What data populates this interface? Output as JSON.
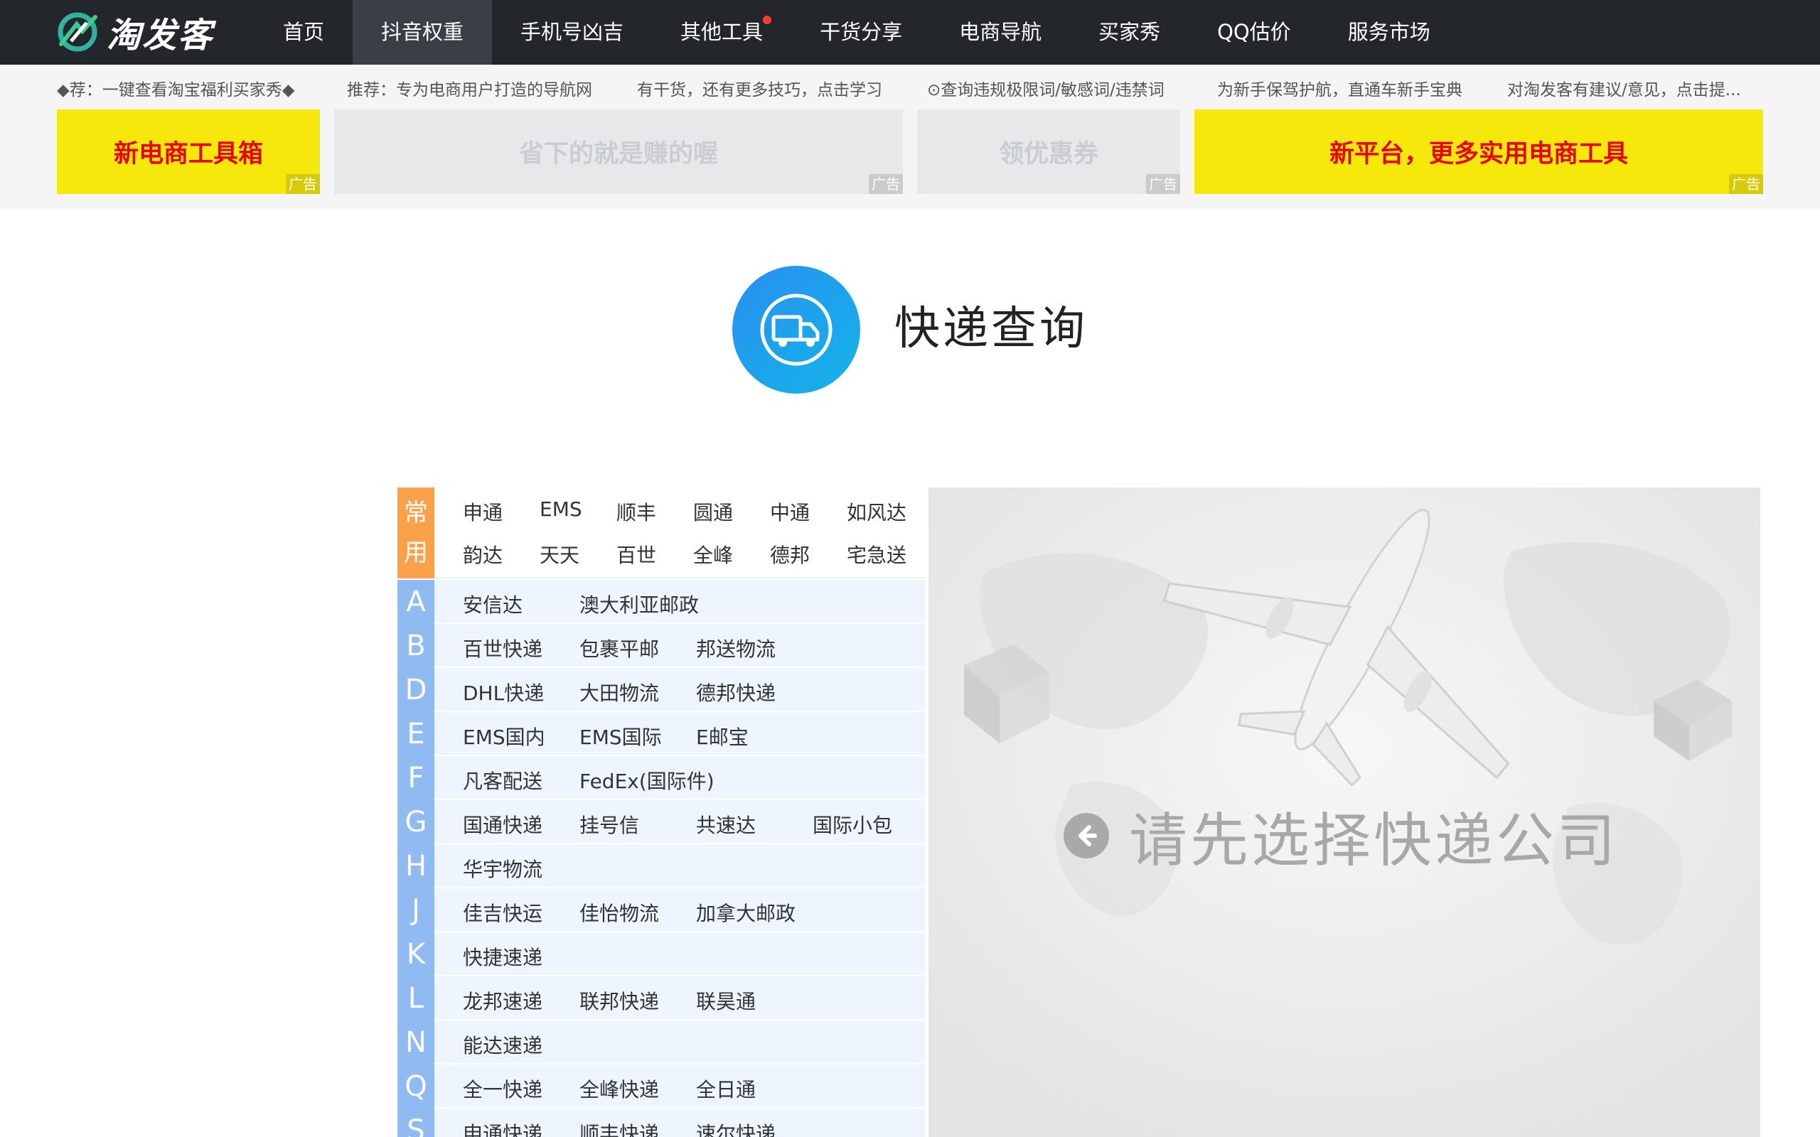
{
  "brand": {
    "name": "淘发客"
  },
  "nav": {
    "items": [
      {
        "label": "首页"
      },
      {
        "label": "抖音权重"
      },
      {
        "label": "手机号凶吉"
      },
      {
        "label": "其他工具"
      },
      {
        "label": "干货分享"
      },
      {
        "label": "电商导航"
      },
      {
        "label": "买家秀"
      },
      {
        "label": "QQ估价"
      },
      {
        "label": "服务市场"
      }
    ],
    "active_index": 1
  },
  "ticker": [
    "◆荐：一键查看淘宝福利买家秀◆",
    "推荐：专为电商用户打造的导航网",
    "有干货，还有更多技巧，点击学习",
    "⊙查询违规极限词/敏感词/违禁词",
    "为新手保驾护航，直通车新手宝典",
    "对淘发客有建议/意见，点击提..."
  ],
  "banners": [
    {
      "text": "新电商工具箱",
      "tag": "广告"
    },
    {
      "text": "省下的就是赚的喔",
      "tag": "广告"
    },
    {
      "text": "领优惠券",
      "tag": "广告"
    },
    {
      "text": "新平台，更多实用电商工具",
      "tag": "广告"
    }
  ],
  "page": {
    "title": "快递查询"
  },
  "courier_common": {
    "label_top": "常",
    "label_bottom": "用",
    "names": [
      "申通",
      "EMS",
      "顺丰",
      "圆通",
      "中通",
      "如风达",
      "韵达",
      "天天",
      "百世",
      "全峰",
      "德邦",
      "宅急送"
    ]
  },
  "courier_groups": [
    {
      "letter": "A",
      "names": [
        "安信达",
        "澳大利亚邮政"
      ]
    },
    {
      "letter": "B",
      "names": [
        "百世快递",
        "包裹平邮",
        "邦送物流"
      ]
    },
    {
      "letter": "D",
      "names": [
        "DHL快递",
        "大田物流",
        "德邦快递"
      ]
    },
    {
      "letter": "E",
      "names": [
        "EMS国内",
        "EMS国际",
        "E邮宝"
      ]
    },
    {
      "letter": "F",
      "names": [
        "凡客配送",
        "FedEx(国际件)"
      ]
    },
    {
      "letter": "G",
      "names": [
        "国通快递",
        "挂号信",
        "共速达",
        "国际小包"
      ]
    },
    {
      "letter": "H",
      "names": [
        "华宇物流"
      ]
    },
    {
      "letter": "J",
      "names": [
        "佳吉快运",
        "佳怡物流",
        "加拿大邮政"
      ]
    },
    {
      "letter": "K",
      "names": [
        "快捷速递"
      ]
    },
    {
      "letter": "L",
      "names": [
        "龙邦速递",
        "联邦快递",
        "联昊通"
      ]
    },
    {
      "letter": "N",
      "names": [
        "能达速递"
      ]
    },
    {
      "letter": "Q",
      "names": [
        "全一快递",
        "全峰快递",
        "全日通"
      ]
    },
    {
      "letter": "S",
      "names": [
        "申通快递",
        "顺丰快递",
        "速尔快递"
      ]
    }
  ],
  "map_panel": {
    "hint": "请先选择快递公司"
  }
}
